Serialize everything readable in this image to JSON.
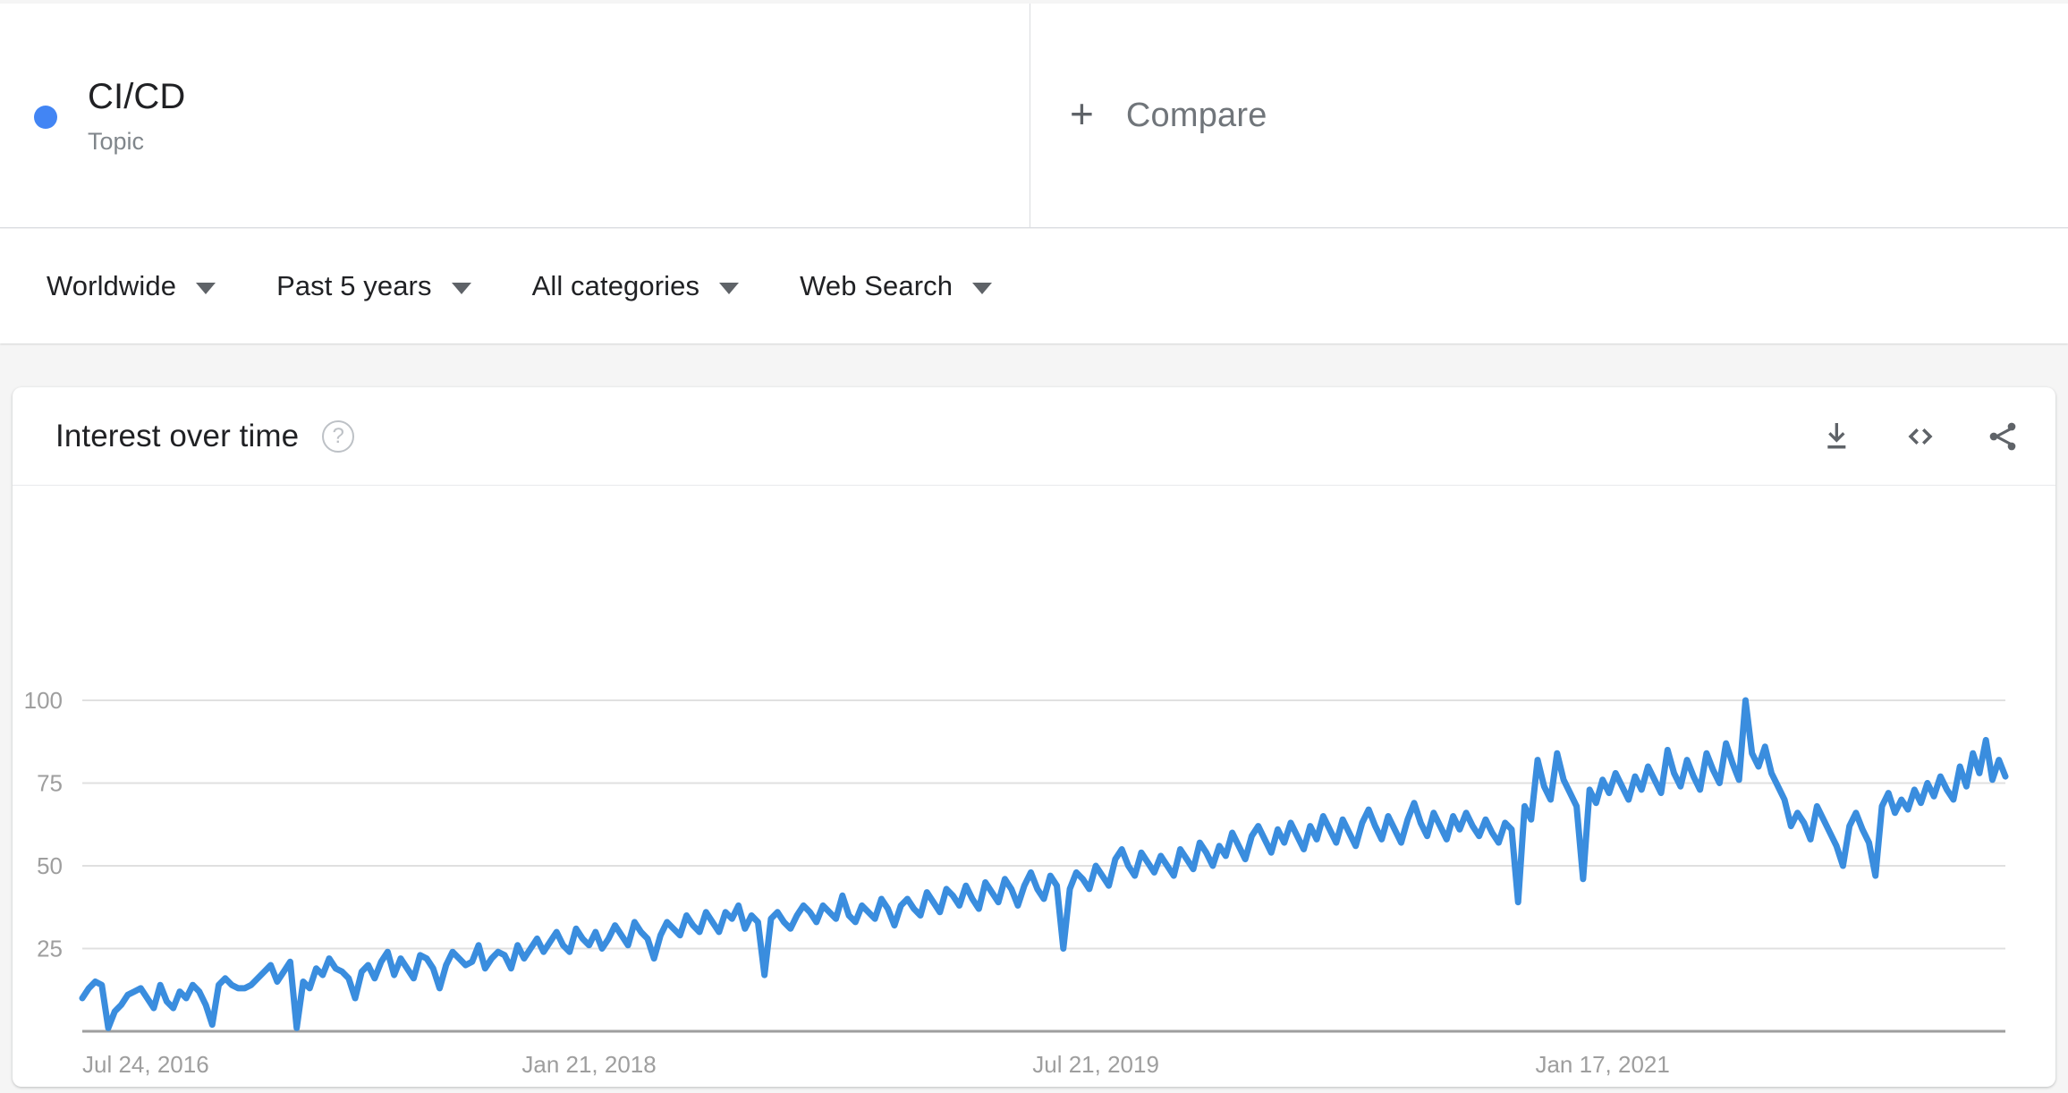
{
  "term": {
    "name": "CI/CD",
    "type_label": "Topic",
    "dot_color": "#4285f4"
  },
  "compare": {
    "plus_glyph": "+",
    "label": "Compare"
  },
  "filters": [
    {
      "label": "Worldwide",
      "name": "location-filter"
    },
    {
      "label": "Past 5 years",
      "name": "time-range-filter"
    },
    {
      "label": "All categories",
      "name": "category-filter"
    },
    {
      "label": "Web Search",
      "name": "search-type-filter"
    }
  ],
  "card": {
    "title": "Interest over time",
    "help_glyph": "?",
    "actions": [
      {
        "name": "download-icon",
        "label": "Download"
      },
      {
        "name": "embed-icon",
        "label": "Embed"
      },
      {
        "name": "share-icon",
        "label": "Share"
      }
    ]
  },
  "chart_data": {
    "type": "line",
    "title": "Interest over time",
    "xlabel": "",
    "ylabel": "",
    "ylim": [
      0,
      100
    ],
    "grid": true,
    "legend_position": "none",
    "line_color": "#3a8dde",
    "grid_color": "#e0e0e0",
    "axis_color": "#9e9e9e",
    "tick_label_color": "#9e9e9e",
    "yticks": [
      100,
      75,
      50,
      25
    ],
    "xtick_labels": [
      "Jul 24, 2016",
      "Jan 21, 2018",
      "Jul 21, 2019",
      "Jan 17, 2021"
    ],
    "xtick_positions": [
      0,
      78,
      156,
      234
    ],
    "series": [
      {
        "name": "CI/CD",
        "color": "#3a8dde",
        "values": [
          10,
          13,
          15,
          14,
          1,
          6,
          8,
          11,
          12,
          13,
          10,
          7,
          14,
          9,
          7,
          12,
          10,
          14,
          12,
          8,
          2,
          14,
          16,
          14,
          13,
          13,
          14,
          16,
          18,
          20,
          15,
          18,
          21,
          1,
          15,
          13,
          19,
          17,
          22,
          19,
          18,
          16,
          10,
          18,
          20,
          16,
          21,
          24,
          17,
          22,
          19,
          16,
          23,
          22,
          19,
          13,
          20,
          24,
          22,
          20,
          21,
          26,
          19,
          22,
          24,
          23,
          19,
          26,
          22,
          25,
          28,
          24,
          27,
          30,
          26,
          24,
          31,
          28,
          26,
          30,
          25,
          28,
          32,
          29,
          26,
          33,
          30,
          28,
          22,
          29,
          33,
          31,
          29,
          35,
          32,
          30,
          36,
          33,
          30,
          36,
          34,
          38,
          31,
          35,
          33,
          17,
          34,
          36,
          33,
          31,
          35,
          38,
          36,
          33,
          38,
          36,
          34,
          41,
          35,
          33,
          38,
          36,
          34,
          40,
          37,
          32,
          38,
          40,
          37,
          35,
          42,
          39,
          36,
          43,
          41,
          38,
          44,
          40,
          37,
          45,
          42,
          39,
          46,
          43,
          38,
          44,
          48,
          43,
          40,
          47,
          44,
          25,
          43,
          48,
          46,
          43,
          50,
          47,
          44,
          52,
          55,
          50,
          47,
          54,
          51,
          48,
          53,
          50,
          47,
          55,
          52,
          49,
          57,
          54,
          50,
          56,
          53,
          60,
          56,
          52,
          59,
          62,
          58,
          54,
          61,
          57,
          63,
          59,
          55,
          62,
          58,
          65,
          61,
          57,
          64,
          60,
          56,
          63,
          67,
          62,
          58,
          65,
          61,
          57,
          64,
          69,
          63,
          59,
          66,
          62,
          58,
          65,
          61,
          66,
          62,
          59,
          64,
          60,
          57,
          63,
          61,
          39,
          68,
          64,
          82,
          74,
          70,
          84,
          76,
          72,
          68,
          46,
          73,
          69,
          76,
          72,
          78,
          74,
          70,
          77,
          73,
          80,
          76,
          72,
          85,
          78,
          74,
          82,
          77,
          73,
          84,
          79,
          75,
          87,
          81,
          76,
          100,
          84,
          80,
          86,
          78,
          74,
          70,
          62,
          66,
          63,
          58,
          68,
          64,
          60,
          56,
          50,
          62,
          66,
          61,
          57,
          47,
          68,
          72,
          66,
          70,
          67,
          73,
          69,
          75,
          71,
          77,
          73,
          70,
          80,
          74,
          84,
          78,
          88,
          76,
          82,
          77
        ]
      }
    ]
  }
}
